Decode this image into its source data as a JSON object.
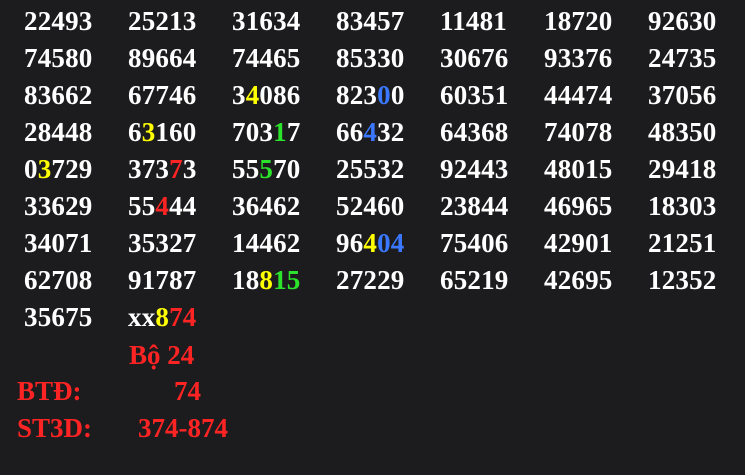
{
  "colors": {
    "background": "#1c1c1e",
    "white": "#ffffff",
    "yellow": "#ffff00",
    "red": "#ff2424",
    "green": "#2be32b",
    "blue": "#3a78ff"
  },
  "rows": [
    [
      [
        {
          "t": "22493",
          "c": "white"
        }
      ],
      [
        {
          "t": "25213",
          "c": "white"
        }
      ],
      [
        {
          "t": "31634",
          "c": "white"
        }
      ],
      [
        {
          "t": "83457",
          "c": "white"
        }
      ],
      [
        {
          "t": "11481",
          "c": "white"
        }
      ],
      [
        {
          "t": "18720",
          "c": "white"
        }
      ],
      [
        {
          "t": "92630",
          "c": "white"
        }
      ]
    ],
    [
      [
        {
          "t": "74580",
          "c": "white"
        }
      ],
      [
        {
          "t": "89664",
          "c": "white"
        }
      ],
      [
        {
          "t": "74465",
          "c": "white"
        }
      ],
      [
        {
          "t": "85330",
          "c": "white"
        }
      ],
      [
        {
          "t": "30676",
          "c": "white"
        }
      ],
      [
        {
          "t": "93376",
          "c": "white"
        }
      ],
      [
        {
          "t": "24735",
          "c": "white"
        }
      ]
    ],
    [
      [
        {
          "t": "83662",
          "c": "white"
        }
      ],
      [
        {
          "t": "67746",
          "c": "white"
        }
      ],
      [
        {
          "t": "3",
          "c": "white"
        },
        {
          "t": "4",
          "c": "yellow"
        },
        {
          "t": "086",
          "c": "white"
        }
      ],
      [
        {
          "t": "823",
          "c": "white"
        },
        {
          "t": "0",
          "c": "blue"
        },
        {
          "t": "0",
          "c": "white"
        }
      ],
      [
        {
          "t": "60351",
          "c": "white"
        }
      ],
      [
        {
          "t": "44474",
          "c": "white"
        }
      ],
      [
        {
          "t": "37056",
          "c": "white"
        }
      ]
    ],
    [
      [
        {
          "t": "28448",
          "c": "white"
        }
      ],
      [
        {
          "t": "6",
          "c": "white"
        },
        {
          "t": "3",
          "c": "yellow"
        },
        {
          "t": "160",
          "c": "white"
        }
      ],
      [
        {
          "t": "703",
          "c": "white"
        },
        {
          "t": "1",
          "c": "green"
        },
        {
          "t": "7",
          "c": "white"
        }
      ],
      [
        {
          "t": "66",
          "c": "white"
        },
        {
          "t": "4",
          "c": "blue"
        },
        {
          "t": "32",
          "c": "white"
        }
      ],
      [
        {
          "t": "64368",
          "c": "white"
        }
      ],
      [
        {
          "t": "74078",
          "c": "white"
        }
      ],
      [
        {
          "t": "48350",
          "c": "white"
        }
      ]
    ],
    [
      [
        {
          "t": "0",
          "c": "white"
        },
        {
          "t": "3",
          "c": "yellow"
        },
        {
          "t": "729",
          "c": "white"
        }
      ],
      [
        {
          "t": "373",
          "c": "white"
        },
        {
          "t": "7",
          "c": "red"
        },
        {
          "t": "3",
          "c": "white"
        }
      ],
      [
        {
          "t": "55",
          "c": "white"
        },
        {
          "t": "5",
          "c": "green"
        },
        {
          "t": "70",
          "c": "white"
        }
      ],
      [
        {
          "t": "25532",
          "c": "white"
        }
      ],
      [
        {
          "t": "92443",
          "c": "white"
        }
      ],
      [
        {
          "t": "48015",
          "c": "white"
        }
      ],
      [
        {
          "t": "29418",
          "c": "white"
        }
      ]
    ],
    [
      [
        {
          "t": "33629",
          "c": "white"
        }
      ],
      [
        {
          "t": "55",
          "c": "white"
        },
        {
          "t": "4",
          "c": "red"
        },
        {
          "t": "44",
          "c": "white"
        }
      ],
      [
        {
          "t": "36462",
          "c": "white"
        }
      ],
      [
        {
          "t": "52460",
          "c": "white"
        }
      ],
      [
        {
          "t": "23844",
          "c": "white"
        }
      ],
      [
        {
          "t": "46965",
          "c": "white"
        }
      ],
      [
        {
          "t": "18303",
          "c": "white"
        }
      ]
    ],
    [
      [
        {
          "t": "34071",
          "c": "white"
        }
      ],
      [
        {
          "t": "35327",
          "c": "white"
        }
      ],
      [
        {
          "t": "14462",
          "c": "white"
        }
      ],
      [
        {
          "t": "96",
          "c": "white"
        },
        {
          "t": "4",
          "c": "yellow"
        },
        {
          "t": "04",
          "c": "blue"
        }
      ],
      [
        {
          "t": "75406",
          "c": "white"
        }
      ],
      [
        {
          "t": "42901",
          "c": "white"
        }
      ],
      [
        {
          "t": "21251",
          "c": "white"
        }
      ]
    ],
    [
      [
        {
          "t": "62708",
          "c": "white"
        }
      ],
      [
        {
          "t": "91787",
          "c": "white"
        }
      ],
      [
        {
          "t": "18",
          "c": "white"
        },
        {
          "t": "8",
          "c": "yellow"
        },
        {
          "t": "15",
          "c": "green"
        }
      ],
      [
        {
          "t": "27229",
          "c": "white"
        }
      ],
      [
        {
          "t": "65219",
          "c": "white"
        }
      ],
      [
        {
          "t": "42695",
          "c": "white"
        }
      ],
      [
        {
          "t": "12352",
          "c": "white"
        }
      ]
    ],
    [
      [
        {
          "t": "35675",
          "c": "white"
        }
      ],
      [
        {
          "t": "xx",
          "c": "white"
        },
        {
          "t": "8",
          "c": "yellow"
        },
        {
          "t": "74",
          "c": "red"
        }
      ]
    ]
  ],
  "summary": {
    "bo_text": "Bộ 24",
    "btd_label": "BTĐ:",
    "btd_value": "74",
    "st3d_label": "ST3D:",
    "st3d_value": "374-874"
  }
}
